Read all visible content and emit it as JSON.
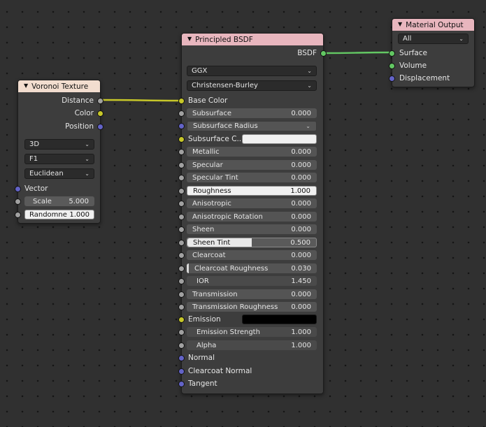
{
  "voronoi": {
    "title": "Voronoi Texture",
    "header_color": "#f2ddcf",
    "outputs": [
      "Distance",
      "Color",
      "Position"
    ],
    "dimensions": "3D",
    "feature": "F1",
    "metric": "Euclidean",
    "vector_label": "Vector",
    "scale_label": "Scale",
    "scale_value": "5.000",
    "randomness_label": "Randomne",
    "randomness_value": "1.000"
  },
  "bsdf": {
    "title": "Principled BSDF",
    "header_color": "#e8b6be",
    "output_label": "BSDF",
    "distribution": "GGX",
    "subsurface_method": "Christensen-Burley",
    "base_color_label": "Base Color",
    "subsurface_label": "Subsurface",
    "subsurface_value": "0.000",
    "subsurface_radius_label": "Subsurface Radius",
    "subsurface_color_label": "Subsurface C..",
    "metallic_label": "Metallic",
    "metallic_value": "0.000",
    "specular_label": "Specular",
    "specular_value": "0.000",
    "specular_tint_label": "Specular Tint",
    "specular_tint_value": "0.000",
    "roughness_label": "Roughness",
    "roughness_value": "1.000",
    "anisotropic_label": "Anisotropic",
    "anisotropic_value": "0.000",
    "anisotropic_rotation_label": "Anisotropic Rotation",
    "anisotropic_rotation_value": "0.000",
    "sheen_label": "Sheen",
    "sheen_value": "0.000",
    "sheen_tint_label": "Sheen Tint",
    "sheen_tint_value": "0.500",
    "sheen_tint_fill": 0.5,
    "clearcoat_label": "Clearcoat",
    "clearcoat_value": "0.000",
    "clearcoat_roughness_label": "Clearcoat Roughness",
    "clearcoat_roughness_value": "0.030",
    "ior_label": "IOR",
    "ior_value": "1.450",
    "transmission_label": "Transmission",
    "transmission_value": "0.000",
    "transmission_roughness_label": "Transmission Roughness",
    "transmission_roughness_value": "0.000",
    "emission_label": "Emission",
    "emission_color": "#000000",
    "subsurface_color": "#f0f0f0",
    "emission_strength_label": "Emission Strength",
    "emission_strength_value": "1.000",
    "alpha_label": "Alpha",
    "alpha_value": "1.000",
    "normal_label": "Normal",
    "clearcoat_normal_label": "Clearcoat Normal",
    "tangent_label": "Tangent"
  },
  "output": {
    "title": "Material Output",
    "header_color": "#e8b6be",
    "target": "All",
    "surface_label": "Surface",
    "volume_label": "Volume",
    "displacement_label": "Displacement"
  },
  "colors": {
    "link_color_to_base": "#c7c729",
    "link_bsdf_to_surface": "#63c763"
  }
}
